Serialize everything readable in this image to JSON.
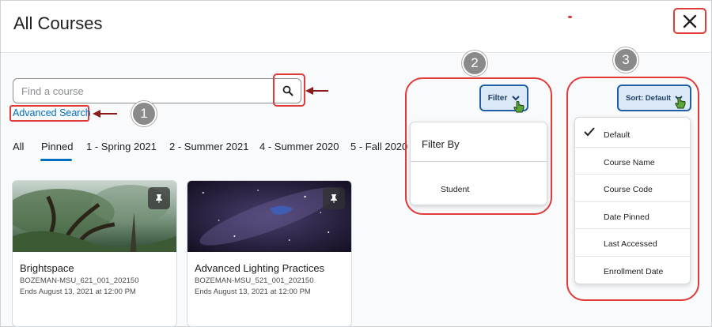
{
  "header": {
    "title": "All Courses"
  },
  "search": {
    "placeholder": "Find a course",
    "advanced_link": "Advanced Search"
  },
  "tabs": [
    {
      "label": "All"
    },
    {
      "label": "Pinned",
      "selected": true
    },
    {
      "label": "1 - Spring 2021"
    },
    {
      "label": "2 - Summer 2021"
    },
    {
      "label": "4 - Summer 2020"
    },
    {
      "label": "5 - Fall 2020"
    }
  ],
  "cards": [
    {
      "title": "Brightspace",
      "code": "BOZEMAN-MSU_621_001_202150",
      "ends": "Ends August 13, 2021 at 12:00 PM"
    },
    {
      "title": "Advanced Lighting Practices",
      "code": "BOZEMAN-MSU_521_001_202150",
      "ends": "Ends August 13, 2021 at 12:00 PM"
    }
  ],
  "filter": {
    "button_label": "Filter",
    "menu_title": "Filter By",
    "options": [
      "Student"
    ]
  },
  "sort": {
    "button_label": "Sort: Default",
    "options": [
      "Default",
      "Course Name",
      "Course Code",
      "Date Pinned",
      "Last Accessed",
      "Enrollment Date"
    ],
    "selected": "Default"
  },
  "badges": {
    "one": "1",
    "two": "2",
    "three": "3"
  },
  "colors": {
    "highlight": "#e03a3a",
    "link": "#006fbf",
    "arrow": "#8b1a1a",
    "button_fill": "#dbe8f5",
    "button_border": "#1f5fa8"
  }
}
